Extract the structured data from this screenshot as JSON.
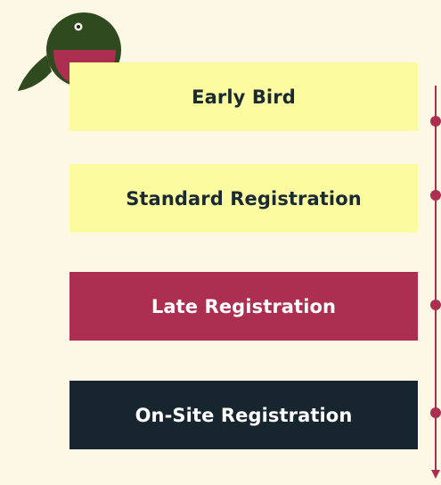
{
  "colors": {
    "background": "#fdf7e6",
    "yellow_card": "#fdfba0",
    "crimson_card": "#ac2e50",
    "navy_card": "#17252f",
    "dark_text": "#1a2a33",
    "light_text": "#ffffff",
    "timeline": "#ac2e50",
    "bird_dark": "#2f4a1f",
    "bird_belly": "#ac2e50"
  },
  "logo": {
    "icon": "bird-logo-icon"
  },
  "tiers": [
    {
      "label": "Early Bird",
      "style": "yellow"
    },
    {
      "label": "Standard Registration",
      "style": "yellow"
    },
    {
      "label": "Late Registration",
      "style": "crimson"
    },
    {
      "label": "On-Site Registration",
      "style": "navy"
    }
  ]
}
